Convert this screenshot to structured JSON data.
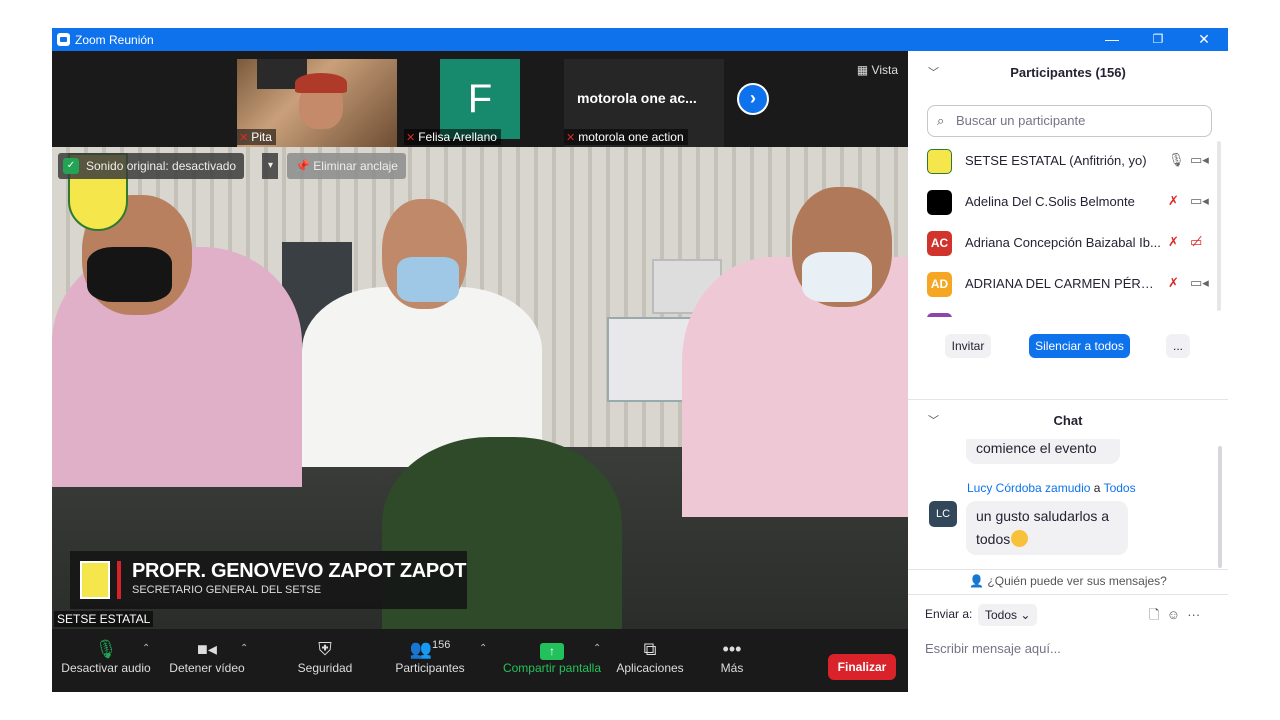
{
  "window": {
    "title": "Zoom Reunión",
    "minimize": "—",
    "restore": "❐",
    "close": "✕"
  },
  "strip": {
    "thumbs": [
      {
        "label": "Pita",
        "muted": true
      },
      {
        "label": "Felisa Arellano",
        "initial": "F",
        "muted": true
      },
      {
        "label": "motorola one action",
        "display": "motorola one ac...",
        "muted": true
      }
    ],
    "vista": "Vista"
  },
  "main_video": {
    "sound_bar": "Sonido original: desactivado",
    "unpin": "Eliminar anclaje",
    "caption_name": "PROFR. GENOVEVO ZAPOT ZAPOT",
    "caption_role": "SECRETARIO GENERAL DEL SETSE",
    "speaker": "SETSE ESTATAL"
  },
  "toolbar": {
    "audio": "Desactivar audio",
    "video": "Detener vídeo",
    "security": "Seguridad",
    "participants": "Participantes",
    "participants_count": "156",
    "share": "Compartir pantalla",
    "apps": "Aplicaciones",
    "more": "Más",
    "end": "Finalizar"
  },
  "participants": {
    "header": "Participantes (156)",
    "search_placeholder": "Buscar un participante",
    "list": [
      {
        "name": "SETSE ESTATAL (Anfitrión, yo)",
        "avatar": "",
        "color": "#f4e64b"
      },
      {
        "name": "Adelina Del C.Solis Belmonte",
        "avatar": "",
        "color": "#000000"
      },
      {
        "name": "Adriana Concepción Baizabal Ib...",
        "avatar": "AC",
        "color": "#d0342c"
      },
      {
        "name": "ADRIANA DEL CARMEN PÉREZ ...",
        "avatar": "AD",
        "color": "#f5a623"
      }
    ],
    "invite": "Invitar",
    "mute_all": "Silenciar a todos",
    "more": "..."
  },
  "chat": {
    "header": "Chat",
    "prev_message": "comience el evento",
    "sender": "Lucy Córdoba zamudio",
    "to_word": "a",
    "recipient": "Todos",
    "sender_initials": "LC",
    "message_line1": "un gusto saludarlos a",
    "message_line2": "todos",
    "who_can_see": "¿Quién puede ver sus mensajes?",
    "send_to_label": "Enviar a:",
    "send_to_value": "Todos",
    "input_placeholder": "Escribir mensaje aquí..."
  }
}
